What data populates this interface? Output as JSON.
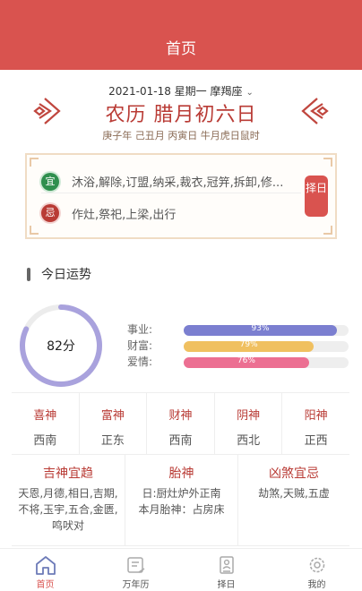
{
  "header": {
    "title": "首页"
  },
  "date": {
    "solar": "2021-01-18 星期一 摩羯座",
    "lunar": "农历 腊月初六日",
    "ganzhi": "庚子年 己丑月 丙寅日 牛月虎日鼠时"
  },
  "yiji": {
    "yi_badge": "宜",
    "yi_text": "沐浴,解除,订盟,纳采,裁衣,冠笄,拆卸,修...",
    "ji_badge": "忌",
    "ji_text": "作灶,祭祀,上梁,出行",
    "zeri_button": "择日"
  },
  "fortune": {
    "title": "今日运势",
    "score_label": "82分",
    "score": 82,
    "items": [
      {
        "label": "事业:",
        "pct_text": "93%",
        "value": 93,
        "color": "#7b7fd0"
      },
      {
        "label": "财富:",
        "pct_text": "79%",
        "value": 79,
        "color": "#f0c060"
      },
      {
        "label": "爱情:",
        "pct_text": "76%",
        "value": 76,
        "color": "#ec6f92"
      }
    ],
    "ring_color": "#a9a2dd"
  },
  "gods": [
    {
      "title": "喜神",
      "dir": "西南"
    },
    {
      "title": "富神",
      "dir": "正东"
    },
    {
      "title": "财神",
      "dir": "西南"
    },
    {
      "title": "阴神",
      "dir": "西北"
    },
    {
      "title": "阳神",
      "dir": "正西"
    }
  ],
  "lower": {
    "jishen": {
      "title": "吉神宜趋",
      "text": "天恩,月德,相日,吉期,不将,玉宇,五合,金匮,鸣吠对"
    },
    "taishen": {
      "title": "胎神",
      "line1": "日:厨灶炉外正南",
      "line2": "本月胎神：占房床"
    },
    "xiongsha": {
      "title": "凶煞宜忌",
      "text": "劫煞,天贼,五虚"
    }
  },
  "tabs": [
    {
      "label": "首页",
      "icon": "house-icon",
      "active": true
    },
    {
      "label": "万年历",
      "icon": "calendar-scroll-icon",
      "active": false
    },
    {
      "label": "择日",
      "icon": "document-person-icon",
      "active": false
    },
    {
      "label": "我的",
      "icon": "gear-icon",
      "active": false
    }
  ],
  "colors": {
    "brand_red": "#d9534f",
    "accent_red": "#b93b35",
    "yi_green": "#2f8f4e"
  }
}
